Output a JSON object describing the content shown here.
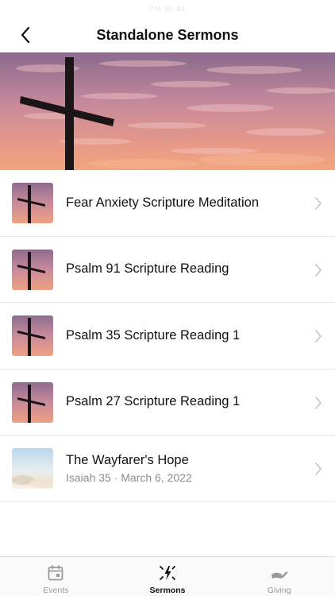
{
  "status_bar": {
    "text": "PM 10:44"
  },
  "header": {
    "title": "Standalone Sermons"
  },
  "sermons": [
    {
      "title": "Fear Anxiety Scripture Meditation",
      "subtitle": "",
      "thumbnail": "cross-icon"
    },
    {
      "title": "Psalm 91 Scripture Reading",
      "subtitle": "",
      "thumbnail": "cross-icon"
    },
    {
      "title": "Psalm 35 Scripture Reading 1",
      "subtitle": "",
      "thumbnail": "cross-icon"
    },
    {
      "title": "Psalm 27 Scripture Reading 1",
      "subtitle": "",
      "thumbnail": "cross-icon"
    },
    {
      "title": "The Wayfarer's Hope",
      "subtitle": "Isaiah 35 · March 6, 2022",
      "thumbnail": "landscape-icon"
    }
  ],
  "tabs": [
    {
      "label": "Events",
      "icon": "calendar-icon",
      "active": false
    },
    {
      "label": "Sermons",
      "icon": "sermons-icon",
      "active": true
    },
    {
      "label": "Giving",
      "icon": "giving-hand-icon",
      "active": false
    }
  ],
  "colors": {
    "accent": "#111111",
    "inactive": "#9a9a9a",
    "divider": "#e6e6e6"
  }
}
